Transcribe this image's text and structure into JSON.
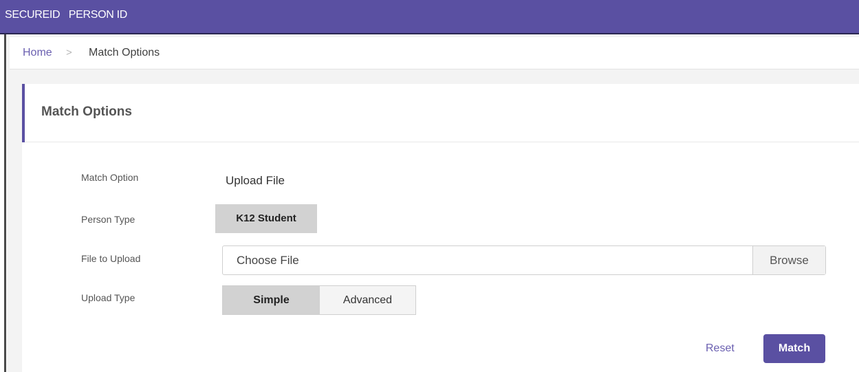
{
  "header": {
    "brand": "SECUREID   PERSON ID"
  },
  "breadcrumb": {
    "home": "Home",
    "separator": ">",
    "current": "Match Options"
  },
  "panel": {
    "title": "Match Options"
  },
  "form": {
    "match_option": {
      "label": "Match Option",
      "value": "Upload File"
    },
    "person_type": {
      "label": "Person Type",
      "value": "K12 Student"
    },
    "file_to_upload": {
      "label": "File to Upload",
      "placeholder": "Choose File",
      "browse_label": "Browse"
    },
    "upload_type": {
      "label": "Upload Type",
      "options": [
        "Simple",
        "Advanced"
      ],
      "selected": "Simple"
    }
  },
  "actions": {
    "reset_label": "Reset",
    "match_label": "Match"
  },
  "colors": {
    "brand": "#5a50a2",
    "link": "#6a5fb0",
    "badge_bg": "#d2d2d2"
  }
}
